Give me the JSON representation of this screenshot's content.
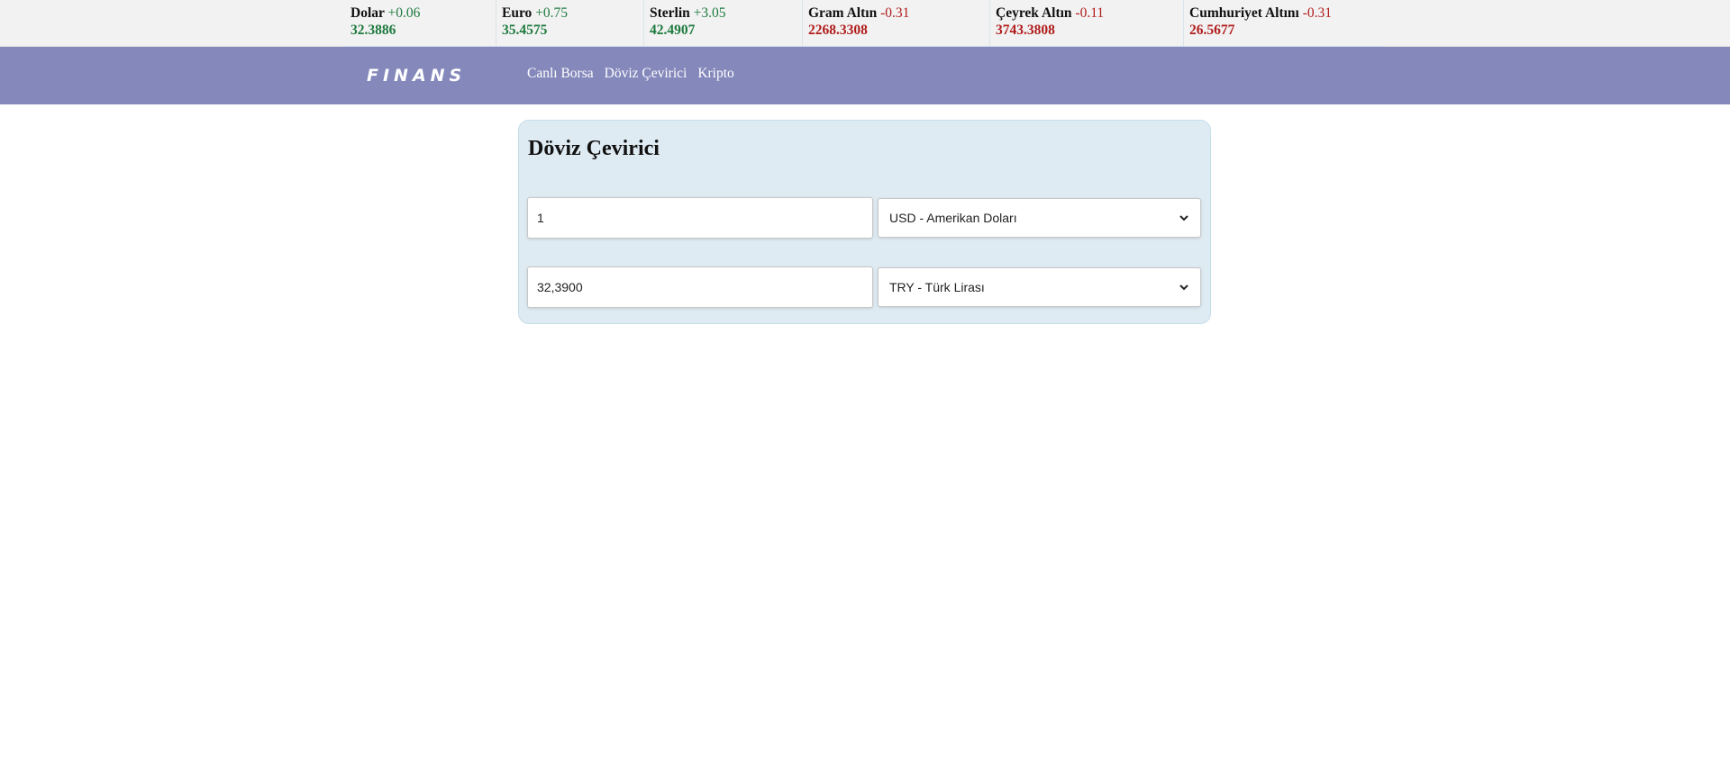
{
  "ticker": [
    {
      "name": "Dolar",
      "change": "+0.06",
      "value": "32.3886",
      "trend": "up"
    },
    {
      "name": "Euro",
      "change": "+0.75",
      "value": "35.4575",
      "trend": "up"
    },
    {
      "name": "Sterlin",
      "change": "+3.05",
      "value": "42.4907",
      "trend": "up"
    },
    {
      "name": "Gram Altın",
      "change": "-0.31",
      "value": "2268.3308",
      "trend": "down"
    },
    {
      "name": "Çeyrek Altın",
      "change": "-0.11",
      "value": "3743.3808",
      "trend": "down"
    },
    {
      "name": "Cumhuriyet Altını",
      "change": "-0.31",
      "value": "26.5677",
      "trend": "down"
    }
  ],
  "nav": {
    "logo": "FINANS",
    "links": [
      "Canlı Borsa",
      "Döviz Çevirici",
      "Kripto"
    ]
  },
  "converter": {
    "title": "Döviz Çevirici",
    "from_amount": "1",
    "from_currency": "USD - Amerikan Doları",
    "to_amount": "32,3900",
    "to_currency": "TRY - Türk Lirası"
  },
  "colors": {
    "navbar": "#8488bb",
    "up": "#1e7a3e",
    "down": "#b11c1c",
    "card_bg": "#dfebf3"
  }
}
